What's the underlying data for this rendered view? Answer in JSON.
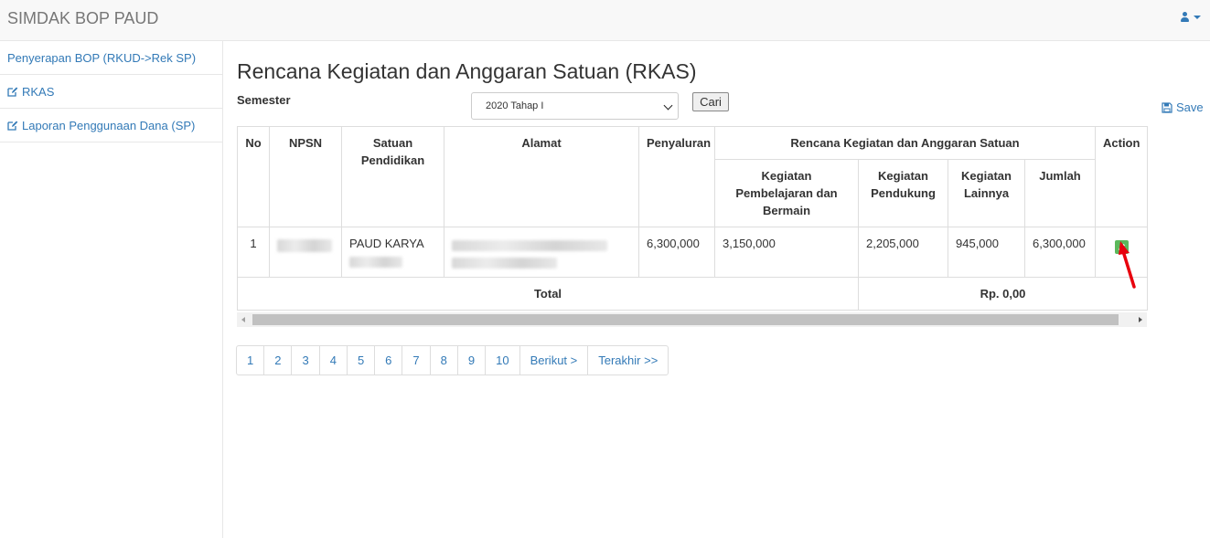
{
  "app": {
    "title": "SIMDAK BOP PAUD"
  },
  "sidebar": {
    "items": [
      {
        "label": "Penyerapan BOP (RKUD->Rek SP)",
        "icon": ""
      },
      {
        "label": "RKAS",
        "icon": "edit-icon"
      },
      {
        "label": "Laporan Penggunaan Dana (SP)",
        "icon": "edit-icon"
      }
    ]
  },
  "main": {
    "title": "Rencana Kegiatan dan Anggaran Satuan (RKAS)",
    "semester_label": "Semester",
    "semester_value": "2020 Tahap I",
    "search_button": "Cari",
    "save_label": "Save"
  },
  "table": {
    "headers": {
      "no": "No",
      "npsn": "NPSN",
      "satuan": "Satuan Pendidikan",
      "alamat": "Alamat",
      "penyaluran": "Penyaluran",
      "rkas_group": "Rencana Kegiatan dan Anggaran Satuan",
      "pembelajaran": "Kegiatan Pembelajaran dan Bermain",
      "pendukung": "Kegiatan Pendukung",
      "lainnya": "Kegiatan Lainnya",
      "jumlah": "Jumlah",
      "action": "Action"
    },
    "rows": [
      {
        "no": "1",
        "satuan": "PAUD KARYA",
        "penyaluran": "6,300,000",
        "pembelajaran": "3,150,000",
        "pendukung": "2,205,000",
        "lainnya": "945,000",
        "jumlah": "6,300,000"
      }
    ],
    "total_label": "Total",
    "total_value": "Rp. 0,00"
  },
  "pagination": {
    "pages": [
      "1",
      "2",
      "3",
      "4",
      "5",
      "6",
      "7",
      "8",
      "9",
      "10"
    ],
    "next": "Berikut >",
    "last": "Terakhir >>"
  },
  "colors": {
    "link": "#337ab7",
    "action_button": "#5cb85c",
    "annotation_arrow": "#e8000d"
  }
}
